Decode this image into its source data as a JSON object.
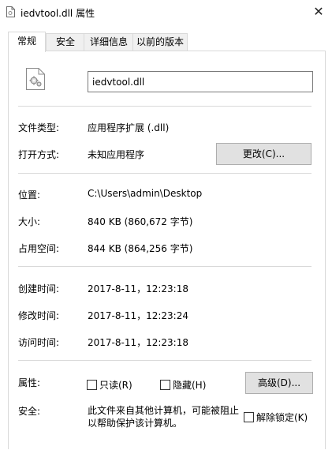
{
  "window": {
    "title": "iedvtool.dll 属性",
    "close_label": "✕"
  },
  "tabs": [
    {
      "label": "常规"
    },
    {
      "label": "安全"
    },
    {
      "label": "详细信息"
    },
    {
      "label": "以前的版本"
    }
  ],
  "general": {
    "file_name": "iedvtool.dll",
    "file_type_label": "文件类型:",
    "file_type_value": "应用程序扩展 (.dll)",
    "opens_with_label": "打开方式:",
    "opens_with_value": "未知应用程序",
    "change_button": "更改(C)...",
    "location_label": "位置:",
    "location_value": "C:\\Users\\admin\\Desktop",
    "size_label": "大小:",
    "size_value": "840 KB (860,672 字节)",
    "size_on_disk_label": "占用空间:",
    "size_on_disk_value": "844 KB (864,256 字节)",
    "created_label": "创建时间:",
    "created_value": "2017-8-11，12:23:18",
    "modified_label": "修改时间:",
    "modified_value": "2017-8-11，12:23:24",
    "accessed_label": "访问时间:",
    "accessed_value": "2017-8-11，12:23:18",
    "attributes_label": "属性:",
    "readonly_label": "只读(R)",
    "hidden_label": "隐藏(H)",
    "advanced_button": "高级(D)...",
    "security_label": "安全:",
    "security_note": "此文件来自其他计算机，可能被阻止以帮助保护该计算机。",
    "unblock_label": "解除锁定(K)"
  },
  "icons": {
    "app": "dll-file-icon",
    "file": "dll-gear-file-icon"
  }
}
